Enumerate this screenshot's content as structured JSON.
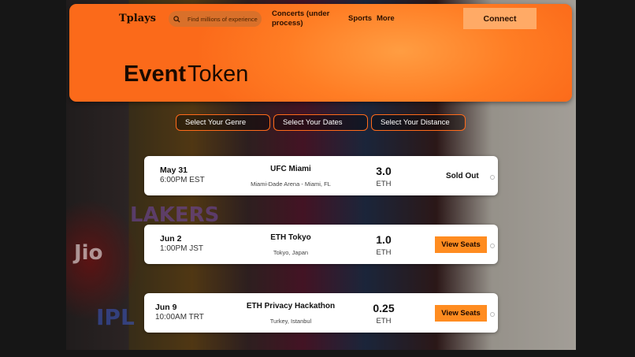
{
  "header": {
    "logo": "Tplays",
    "search_placeholder": "Find millions of experience",
    "nav": [
      "Concerts (under process)",
      "Sports",
      "More"
    ],
    "connect_label": "Connect",
    "title_bold": "Event",
    "title_light": "Token"
  },
  "background": {
    "marks": [
      "Jio",
      "IPL",
      "LAKERS"
    ]
  },
  "filters": [
    "Select Your Genre",
    "Select Your Dates",
    "Select Your Distance"
  ],
  "events": [
    {
      "date": "May 31",
      "time": "6:00PM EST",
      "name": "UFC Miami",
      "location": "Miami-Dade Arena - Miami, FL",
      "price": "3.0",
      "currency": "ETH",
      "status": "Sold Out"
    },
    {
      "date": "Jun 2",
      "time": "1:00PM JST",
      "name": "ETH Tokyo",
      "location": "Tokyo, Japan",
      "price": "1.0",
      "currency": "ETH",
      "action": "View Seats"
    },
    {
      "date": "Jun 9",
      "time": "10:00AM TRT",
      "name": "ETH Privacy Hackathon",
      "location": "Turkey, Istanbul",
      "price": "0.25",
      "currency": "ETH",
      "action": "View Seats"
    }
  ],
  "colors": {
    "accent": "#ff7d24",
    "button": "#ff8c20",
    "filter_border": "#ff6a1a"
  }
}
